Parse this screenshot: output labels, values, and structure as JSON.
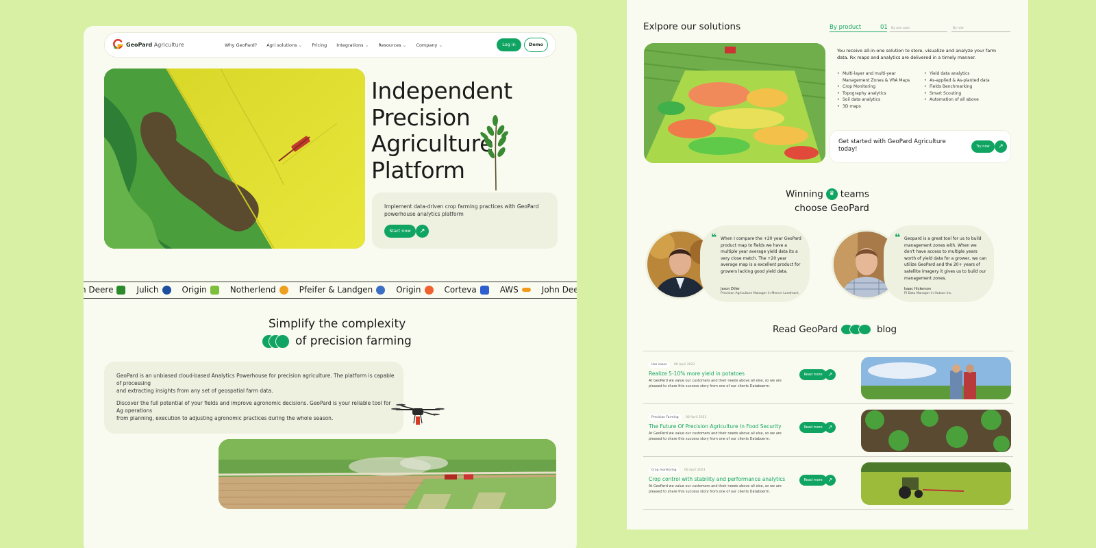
{
  "nav": {
    "brand_bold": "GeoPard",
    "brand_light": "Agriculture",
    "items": [
      {
        "label": "Why GeoPard?",
        "dropdown": false
      },
      {
        "label": "Agri solutions",
        "dropdown": true
      },
      {
        "label": "Pricing",
        "dropdown": false
      },
      {
        "label": "Integrations",
        "dropdown": true
      },
      {
        "label": "Resources",
        "dropdown": true
      },
      {
        "label": "Company",
        "dropdown": true
      }
    ],
    "login": "Log in",
    "demo": "Demo"
  },
  "hero": {
    "title_lines": [
      "Independent",
      "Precision",
      "Agriculture",
      "Platform"
    ],
    "subtitle": "Implement data-driven crop farming practices with GeoPard powerhouse analytics platform",
    "cta": "Start now",
    "arrow": "↗"
  },
  "ticker": [
    {
      "name": "n Deere",
      "color": "#2b8a2b"
    },
    {
      "name": "Julich",
      "color": "#1d4fa0"
    },
    {
      "name": "Origin",
      "color": "#7cbf3a"
    },
    {
      "name": "Notherlend",
      "color": "#f0a020"
    },
    {
      "name": "Pfeifer & Landgen",
      "color": "#3b6ec4"
    },
    {
      "name": "Origin",
      "color": "#f06030"
    },
    {
      "name": "Corteva",
      "color": "#2e5ecf"
    },
    {
      "name": "AWS",
      "color": "#f29a1a"
    },
    {
      "name": "John Deere",
      "color": "#2b8a2b"
    }
  ],
  "simplify": {
    "title_line1": "Simplify the complexity",
    "title_line2": "of precision farming",
    "para1_a": "GeoPard is an unbiased cloud-based Analytics Powerhouse for precision agriculture. The platform is capable of processing",
    "para1_b": "and extracting insights from any set of geospatial farm data.",
    "para2_a": "Discover the full potential of your fields and improve agronomic decisions. GeoPard is your reliable tool for Ag operations",
    "para2_b": "from planning, execution to adjusting agronomic practices during the whole season."
  },
  "solutions": {
    "title": "Exlpore our solutions",
    "tab_active": "By product",
    "tab_active_num": "01",
    "tab2": "By use case",
    "tab3": "By role",
    "description": "You receive all-in-one solution to store, visualize and analyze your farm data. Rx maps and analytics are delivered in a timely manner.",
    "features_left": [
      "Multi-layer and multi-year Management Zones & VRA Maps",
      "Crop Monitoring",
      "Topography analytics",
      "Soil data analytics",
      "3D maps"
    ],
    "features_right": [
      "Yield data analytics",
      "As-applied & As-planted data",
      "Fields Benchmarking",
      "Smart Scouting",
      "Automation of all above"
    ],
    "get_started": "Get started with GeoPard Agriculture today!",
    "try_now": "Try now",
    "arrow": "↗"
  },
  "testimonials": {
    "title_a": "Winning",
    "title_b": "teams",
    "title_line2": "choose GeoPard",
    "trophy": "🏆",
    "items": [
      {
        "quote": "When I compare the +20 year GeoPard product map to fields we have a multiple year average yield data its a very close match. The +20 year average map is a excellent product for growers lacking good yield data.",
        "name": "Jason Diller",
        "role": "Precision Agriculture Manager in Mercer Landmark"
      },
      {
        "quote": "Geopard is a great tool for us to build management zones with. When we don't have access to multiple years worth of yield data for a grower, we can utilize GeoPard and the 20+ years of satellite imagery it gives us to build our management zones.",
        "name": "Isaac Hickerson",
        "role": "PI Data Manager in Hutson Inc."
      }
    ],
    "quote_mark": "❝"
  },
  "blog": {
    "title_a": "Read GeoPard",
    "title_b": "blog",
    "read_more": "Read more",
    "arrow": "↗",
    "items": [
      {
        "category": "Use cases",
        "date": "06 April 2023",
        "title": "Realize 5-10% more yield in potatoes",
        "body": "At GeoPard we value our customers and their needs above all else, so we are pleased to share this success story from one of our clients Databoerrn."
      },
      {
        "category": "Precision Farming",
        "date": "06 April 2023",
        "title": "The Future Of Precision Agriculture In Food Security",
        "body": "At GeoPard we value our customers and their needs above all else, so we are pleased to share this success story from one of our clients Databoerrn."
      },
      {
        "category": "Crop monitoring",
        "date": "06 April 2023",
        "title": "Crop control with stability and performance analytics",
        "body": "At GeoPard we value our customers and their needs above all else, so we are pleased to share this success story from one of our clients Databoerrn."
      }
    ]
  }
}
